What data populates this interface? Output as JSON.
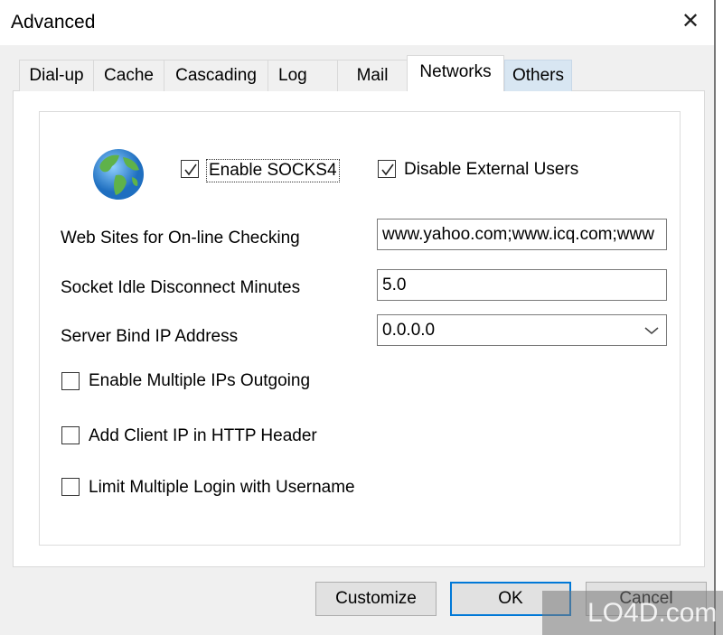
{
  "window": {
    "title": "Advanced",
    "close_icon": "close-icon"
  },
  "tabs": [
    {
      "label": "Dial-up"
    },
    {
      "label": "Cache"
    },
    {
      "label": "Cascading"
    },
    {
      "label": "Log"
    },
    {
      "label": "Mail"
    },
    {
      "label": "Networks",
      "selected": true
    },
    {
      "label": "Others",
      "hovered": true
    }
  ],
  "networks": {
    "globe_icon": "globe-icon",
    "enable_socks4": {
      "label": "Enable SOCKS4",
      "checked": true
    },
    "disable_external": {
      "label": "Disable External Users",
      "checked": true
    },
    "web_sites": {
      "label": "Web Sites for On-line Checking",
      "value": "www.yahoo.com;www.icq.com;www"
    },
    "idle": {
      "label": "Socket Idle Disconnect Minutes",
      "value": "5.0"
    },
    "bind_ip": {
      "label": "Server Bind IP Address",
      "value": "0.0.0.0"
    },
    "multi_ips": {
      "label": "Enable Multiple IPs Outgoing",
      "checked": false
    },
    "client_ip": {
      "label": "Add Client IP in HTTP Header",
      "checked": false
    },
    "limit_login": {
      "label": "Limit Multiple Login with Username",
      "checked": false
    }
  },
  "buttons": {
    "customize": "Customize",
    "ok": "OK",
    "cancel": "Cancel"
  },
  "watermark": "LO4D.com",
  "colors": {
    "accent": "#0078d7",
    "hover_tab": "#d8e6f2"
  }
}
